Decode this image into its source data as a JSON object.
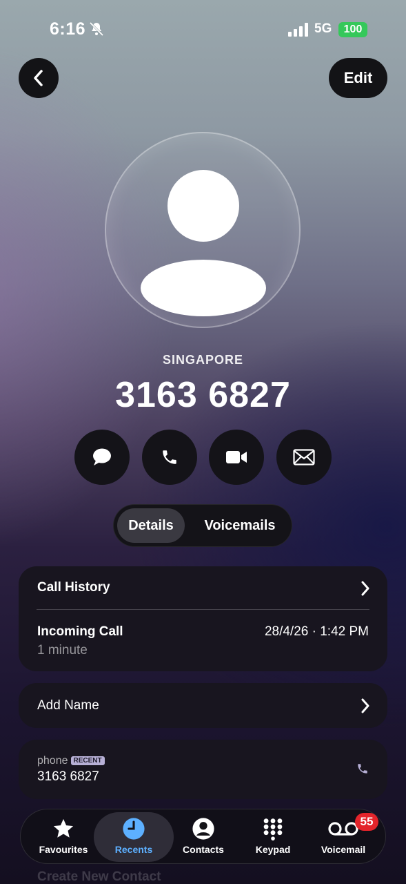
{
  "status": {
    "time": "6:16",
    "network": "5G",
    "battery": "100",
    "colors": {
      "battery": "#35c85a"
    }
  },
  "header": {
    "back_icon": "chevron-left-icon",
    "edit_label": "Edit"
  },
  "contact": {
    "location": "SINGAPORE",
    "number": "3163 6827",
    "avatar_icon": "person-placeholder-icon"
  },
  "actions": [
    {
      "icon": "message-icon"
    },
    {
      "icon": "phone-icon"
    },
    {
      "icon": "video-icon"
    },
    {
      "icon": "mail-icon"
    }
  ],
  "segmented": {
    "active": "Details",
    "other": "Voicemails"
  },
  "call_history": {
    "title": "Call History",
    "entry_type": "Incoming Call",
    "entry_duration": "1 minute",
    "entry_datetime": "28/4/26 · 1:42 PM"
  },
  "add_name": {
    "label": "Add Name"
  },
  "phone_row": {
    "label": "phone",
    "badge": "RECENT",
    "value": "3163 6827"
  },
  "tabs": [
    {
      "label": "Favourites",
      "icon": "star-icon"
    },
    {
      "label": "Recents",
      "icon": "clock-icon",
      "active": true
    },
    {
      "label": "Contacts",
      "icon": "person-circle-icon"
    },
    {
      "label": "Keypad",
      "icon": "keypad-icon"
    },
    {
      "label": "Voicemail",
      "icon": "voicemail-icon",
      "badge": "55"
    }
  ],
  "footer": {
    "create_contact": "Create New Contact"
  },
  "colors": {
    "accent": "#5db0ff",
    "badge_red": "#e3242b"
  }
}
